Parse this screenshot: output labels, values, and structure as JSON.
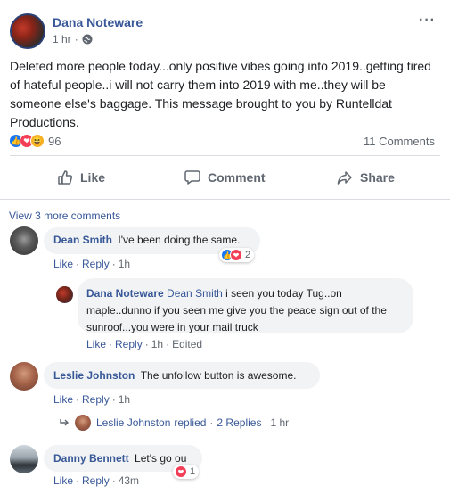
{
  "post": {
    "author": "Dana Noteware",
    "time": "1 hr",
    "more": "···",
    "body": "Deleted more people today...only positive vibes going into 2019..getting tired of hateful people..i will not carry them into 2019 with me..they will be someone else's baggage. This message brought to you by Runtelldat Productions.",
    "reaction_count": "96",
    "comment_count": "11 Comments"
  },
  "actions": {
    "like": "Like",
    "comment": "Comment",
    "share": "Share"
  },
  "view_more": "View 3 more comments",
  "comments": [
    {
      "name": "Dean Smith",
      "text": "I've been doing the same.",
      "like": "Like",
      "reply": "Reply",
      "time": "1h",
      "reactions": "2"
    },
    {
      "name": "Dana Noteware",
      "mention": "Dean Smith",
      "text": "i seen you today Tug..on maple..dunno if you seen me give you the peace sign out of the sunroof...you were in your mail truck",
      "like": "Like",
      "reply": "Reply",
      "time": "1h",
      "edited": "Edited"
    },
    {
      "name": "Leslie Johnston",
      "text": "The unfollow button is awesome.",
      "like": "Like",
      "reply": "Reply",
      "time": "1h"
    },
    {
      "name": "Danny Bennett",
      "text": "Let's go ou",
      "like": "Like",
      "reply": "Reply",
      "time": "43m",
      "reactions": "1"
    }
  ],
  "replies_summary": {
    "name": "Leslie Johnston",
    "verb": "replied",
    "count": "2 Replies",
    "time": "1 hr"
  },
  "colors": {
    "link": "#385898",
    "like": "#1877f2",
    "love": "#f33e58",
    "haha": "#f7b125",
    "bubble": "#f2f3f5"
  }
}
